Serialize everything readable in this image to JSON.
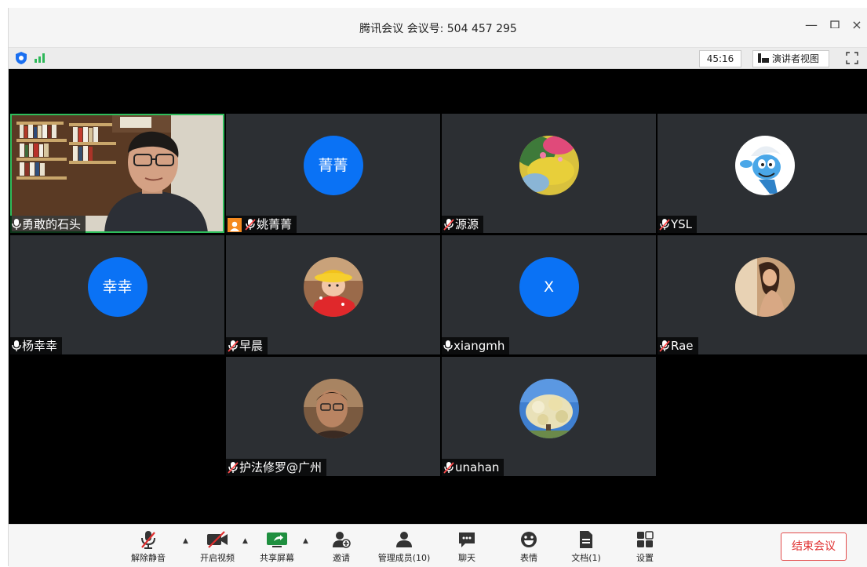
{
  "window": {
    "title": "腾讯会议 会议号: 504 457 295"
  },
  "status": {
    "timer": "45:16",
    "presenter_view": "演讲者视图"
  },
  "participants": [
    {
      "name": "勇敢的石头",
      "mic": "on",
      "avatar": "video"
    },
    {
      "name": "姚菁菁",
      "mic": "muted",
      "avatar": "text",
      "avatar_text": "菁菁",
      "host": true
    },
    {
      "name": "源源",
      "mic": "muted",
      "avatar": "photo"
    },
    {
      "name": "YSL",
      "mic": "muted",
      "avatar": "photo"
    },
    {
      "name": "杨幸幸",
      "mic": "on",
      "avatar": "text",
      "avatar_text": "幸幸"
    },
    {
      "name": "早晨",
      "mic": "muted",
      "avatar": "photo"
    },
    {
      "name": "xiangmh",
      "mic": "on",
      "avatar": "text",
      "avatar_text": "X"
    },
    {
      "name": "Rae",
      "mic": "muted",
      "avatar": "photo"
    },
    {
      "name": "护法修罗@广州",
      "mic": "muted",
      "avatar": "photo"
    },
    {
      "name": "unahan",
      "mic": "muted",
      "avatar": "photo"
    }
  ],
  "toolbar": {
    "unmute": "解除静音",
    "start_video": "开启视频",
    "share_screen": "共享屏幕",
    "invite": "邀请",
    "manage_members": "管理成员(10)",
    "chat": "聊天",
    "reactions": "表情",
    "docs": "文档(1)",
    "settings": "设置",
    "end_meeting": "结束会议"
  },
  "colors": {
    "avatar_blue": "#0a72f5",
    "active_border": "#2ebd5b",
    "end_red": "#e02f2f",
    "host_badge": "#f58a1f"
  }
}
